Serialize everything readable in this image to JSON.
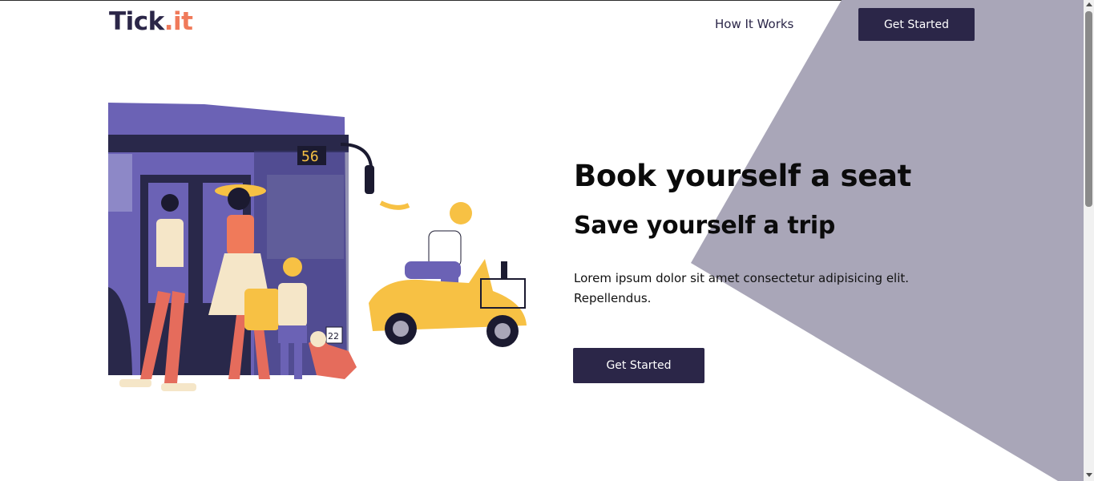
{
  "brand": {
    "logo_main": "Tick",
    "logo_accent": ".it",
    "logo_main_color": "#2b2648",
    "logo_accent_color": "#f07a5a"
  },
  "nav": {
    "how_it_works": "How It Works",
    "get_started": "Get Started"
  },
  "hero": {
    "title": "Book yourself a seat",
    "subtitle": "Save yourself a trip",
    "description": "Lorem ipsum dolor sit amet consectetur adipisicing elit. Repellendus.",
    "cta": "Get Started",
    "illustration": {
      "bus_number": "56",
      "plate_text": "22"
    }
  },
  "colors": {
    "primary": "#2b2648",
    "accent": "#f07a5a",
    "background_shape": "#a9a6b8",
    "bus": "#6b62b5",
    "scooter": "#f7c144"
  }
}
